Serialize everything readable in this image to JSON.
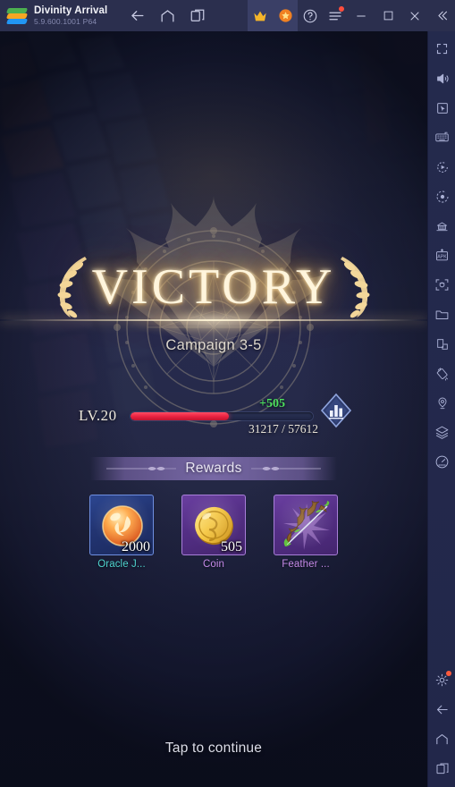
{
  "titlebar": {
    "app_name": "Divinity Arrival",
    "version": "5.9.600.1001 P64",
    "nav": [
      {
        "name": "back-icon",
        "label": "Back"
      },
      {
        "name": "home-icon",
        "label": "Home"
      },
      {
        "name": "multi-instance-icon",
        "label": "Multi-instance"
      }
    ],
    "actions": [
      {
        "name": "crown-icon",
        "label": "Premium"
      },
      {
        "name": "star-badge-icon",
        "label": "Rewards"
      },
      {
        "name": "help-icon",
        "label": "Help"
      },
      {
        "name": "menu-icon",
        "label": "Menu",
        "badge": true
      }
    ],
    "window": [
      {
        "name": "minimize-button",
        "label": "Minimize"
      },
      {
        "name": "maximize-button",
        "label": "Maximize"
      },
      {
        "name": "close-button",
        "label": "Close"
      },
      {
        "name": "collapse-button",
        "label": "Collapse"
      }
    ]
  },
  "game": {
    "result_title": "VICTORY",
    "stage_label": "Campaign 3-5",
    "level": "LV.20",
    "xp_gain": "+505",
    "xp_progress": "31217 / 57612",
    "xp_percent": 54,
    "rank_badge": "power-rating-badge",
    "rewards_heading": "Rewards",
    "rewards": [
      {
        "name": "Oracle J...",
        "qty": "2000",
        "tile": "blue",
        "icon": "orb-icon",
        "label_color": "#4fd4cf"
      },
      {
        "name": "Coin",
        "qty": "505",
        "tile": "purple",
        "icon": "coin-icon",
        "label_color": "#c48ae8"
      },
      {
        "name": "Feather ...",
        "qty": "",
        "tile": "purple",
        "icon": "bow-icon",
        "label_color": "#c48ae8"
      }
    ],
    "continue_hint": "Tap to continue",
    "colors": {
      "xp_fill": "#e8203f",
      "xp_gain": "#4ce05d",
      "victory_gold": "#fff5dc",
      "banner_purple": "#7c6caa"
    }
  },
  "sidebar": {
    "top_items": [
      {
        "name": "fullscreen-icon",
        "label": "Fullscreen"
      },
      {
        "name": "volume-icon",
        "label": "Volume"
      },
      {
        "name": "cursor-icon",
        "label": "Game controls"
      },
      {
        "name": "keyboard-icon",
        "label": "Keyboard controls"
      },
      {
        "name": "record-icon",
        "label": "Record screen"
      },
      {
        "name": "macro-icon",
        "label": "Macro recorder"
      },
      {
        "name": "multi-instance-sync-icon",
        "label": "Multi-instance sync"
      },
      {
        "name": "apk-install-icon",
        "label": "Install APK"
      },
      {
        "name": "screenshot-icon",
        "label": "Screenshot"
      },
      {
        "name": "folder-icon",
        "label": "Media manager"
      },
      {
        "name": "resize-icon",
        "label": "Resize"
      },
      {
        "name": "shake-icon",
        "label": "Shake"
      },
      {
        "name": "location-icon",
        "label": "Location"
      },
      {
        "name": "layers-icon",
        "label": "Layers"
      },
      {
        "name": "performance-icon",
        "label": "Performance"
      }
    ],
    "bottom_items": [
      {
        "name": "settings-gear-icon",
        "label": "Settings",
        "badge": true
      },
      {
        "name": "android-back-icon",
        "label": "Back"
      },
      {
        "name": "android-home-icon",
        "label": "Home"
      },
      {
        "name": "android-recents-icon",
        "label": "Recent apps"
      }
    ]
  }
}
